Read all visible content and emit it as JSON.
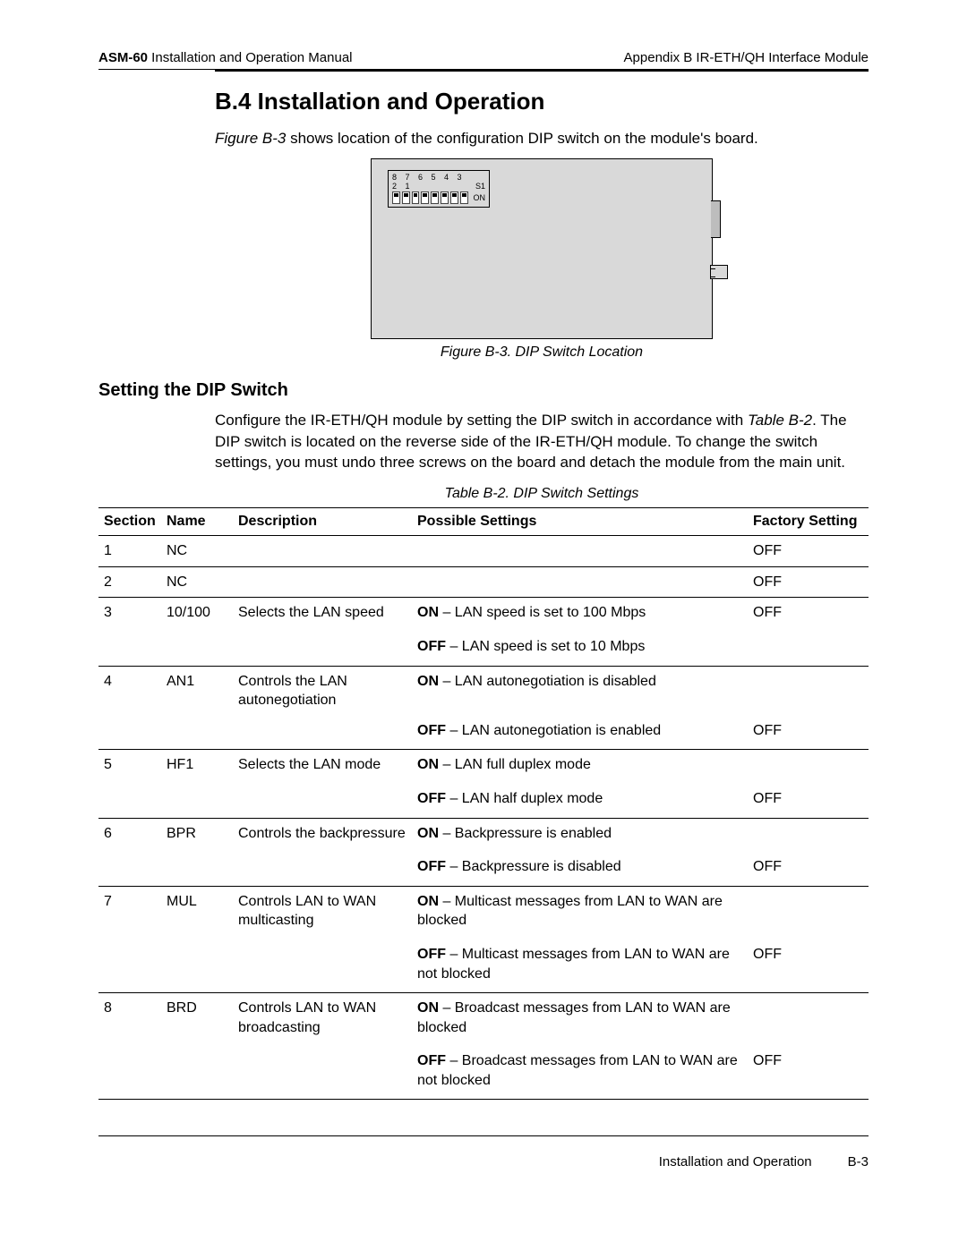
{
  "header": {
    "left_bold": "ASM-60",
    "left_rest": " Installation and Operation Manual",
    "right": "Appendix B  IR-ETH/QH Interface Module"
  },
  "title": "B.4  Installation and Operation",
  "intro_fig_ref": "Figure B-3",
  "intro_rest": " shows location of the configuration DIP switch on the module's board.",
  "dip_label_nums": "8 7 6 5 4 3 2 1",
  "dip_label_s1": "S1",
  "dip_label_on": "ON",
  "fig_caption": "Figure B-3.  DIP Switch Location",
  "subheading": "Setting the DIP Switch",
  "para_pre": "Configure the IR-ETH/QH module by setting the DIP switch in accordance with ",
  "para_ref": "Table B-2",
  "para_post": ". The DIP switch is located on the reverse side of the IR-ETH/QH module. To change the switch settings, you must undo three screws on the board and detach the module from the main unit.",
  "table_caption": "Table B-2.  DIP Switch Settings",
  "th": {
    "section": "Section",
    "name": "Name",
    "desc": "Description",
    "poss": "Possible Settings",
    "fact": "Factory Setting"
  },
  "rows": {
    "r1": {
      "sec": "1",
      "name": "NC",
      "desc": "",
      "fact": "OFF"
    },
    "r2": {
      "sec": "2",
      "name": "NC",
      "desc": "",
      "fact": "OFF"
    },
    "r3": {
      "sec": "3",
      "name": "10/100",
      "desc": "Selects the LAN speed",
      "on": " – LAN speed is set to 100 Mbps",
      "off": " – LAN speed is set to 10 Mbps",
      "fact": "OFF"
    },
    "r4": {
      "sec": "4",
      "name": "AN1",
      "desc": "Controls the LAN autonegotiation",
      "on": " – LAN autonegotiation is disabled",
      "off": " – LAN autonegotiation is enabled",
      "fact": "OFF"
    },
    "r5": {
      "sec": "5",
      "name": "HF1",
      "desc": "Selects the LAN mode",
      "on": " – LAN full duplex mode",
      "off": " – LAN half duplex mode",
      "fact": "OFF"
    },
    "r6": {
      "sec": "6",
      "name": "BPR",
      "desc": "Controls the backpressure",
      "on": " – Backpressure is enabled",
      "off": " – Backpressure is disabled",
      "fact": "OFF"
    },
    "r7": {
      "sec": "7",
      "name": "MUL",
      "desc": "Controls LAN to WAN multicasting",
      "on": " – Multicast messages from LAN to WAN are blocked",
      "off": " – Multicast messages from LAN to WAN are not blocked",
      "fact": "OFF"
    },
    "r8": {
      "sec": "8",
      "name": "BRD",
      "desc": "Controls LAN to WAN broadcasting",
      "on": " – Broadcast messages from LAN to WAN are blocked",
      "off": " – Broadcast messages from LAN to WAN are not blocked",
      "fact": "OFF"
    }
  },
  "labels": {
    "on": "ON",
    "off": "OFF"
  },
  "footer": {
    "title": "Installation and Operation",
    "page": "B-3"
  }
}
